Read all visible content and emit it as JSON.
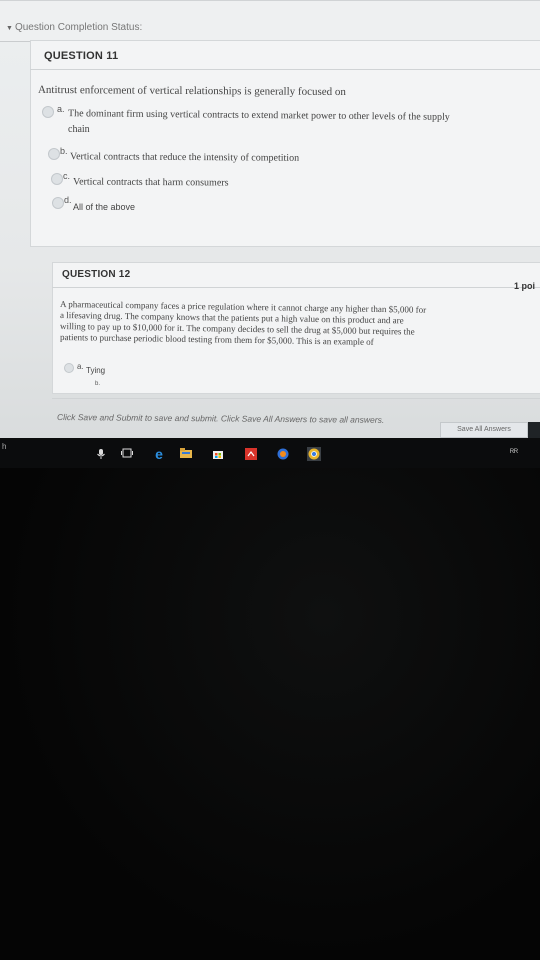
{
  "status": {
    "label": "Question Completion Status:"
  },
  "q11": {
    "heading": "QUESTION 11",
    "prompt": "Antitrust enforcement of vertical relationships is generally focused on",
    "options": [
      {
        "letter": "a.",
        "text": "The dominant firm using vertical contracts to extend market power to other levels of the supply",
        "text2": "chain"
      },
      {
        "letter": "b.",
        "text": "Vertical contracts that reduce the intensity of competition"
      },
      {
        "letter": "c.",
        "text": "Vertical contracts that harm consumers"
      },
      {
        "letter": "d.",
        "text": "All of the above"
      }
    ]
  },
  "q12": {
    "heading": "QUESTION 12",
    "points": "1 poi",
    "prompt_lines": [
      "A pharmaceutical company faces a price regulation where it cannot charge any higher than $5,000 for",
      "a lifesaving drug. The company knows that the patients put a high value on this product and are",
      "willing to pay up to $10,000 for it. The company decides to sell the drug at $5,000 but requires the",
      "patients to purchase periodic blood testing from them for $5,000. This is an example of"
    ],
    "options": [
      {
        "letter": "a.",
        "text": "Tying"
      },
      {
        "letter": "b.",
        "text": ""
      }
    ]
  },
  "footer": {
    "instructions": "Click Save and Submit to save and submit. Click Save All Answers to save all answers.",
    "save_all": "Save All Answers"
  },
  "taskbar": {
    "left_fragment": "h",
    "icons": [
      "microphone-icon",
      "task-view-icon",
      "edge-icon",
      "file-explorer-icon",
      "store-icon",
      "app-red-icon",
      "media-icon",
      "chrome-icon"
    ]
  }
}
